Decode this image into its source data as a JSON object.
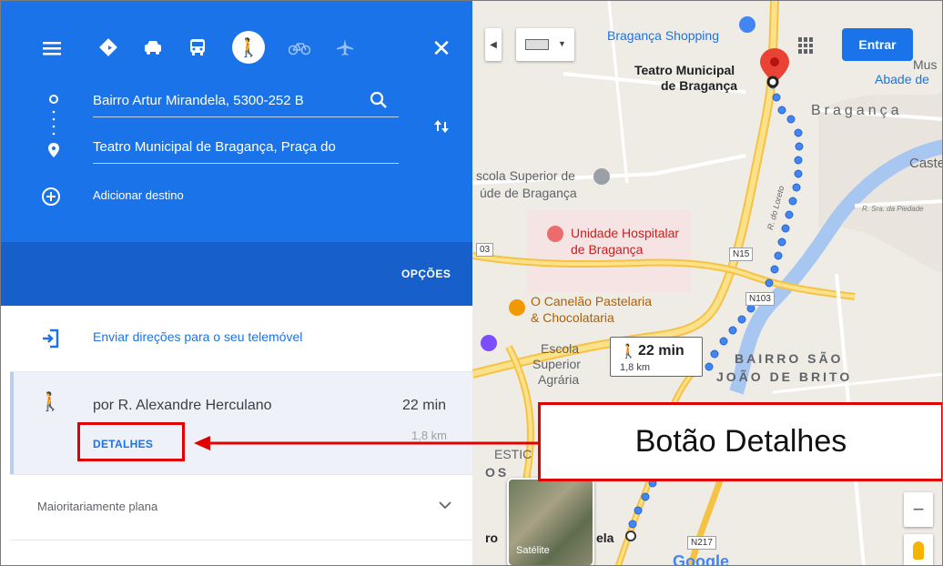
{
  "panel": {
    "origin": "Bairro Artur Mirandela, 5300-252 B",
    "destination": "Teatro Municipal de Bragança, Praça do",
    "add_destination": "Adicionar destino",
    "options": "OPÇÕES",
    "send_link": "Enviar direções para o seu telemóvel",
    "route_name": "por R. Alexandre Herculano",
    "route_time": "22 min",
    "route_distance": "1,8 km",
    "details_label": "DETALHES",
    "terrain": "Maioritariamente plana",
    "modes": [
      "best-route-icon",
      "car-icon",
      "transit-icon",
      "walking-icon",
      "bicycle-icon",
      "flight-icon"
    ],
    "active_mode": "walking-icon"
  },
  "map": {
    "signin": "Entrar",
    "teatro_line1": "Teatro Municipal",
    "teatro_line2": "de Bragança",
    "braganca_shopping": "Bragança Shopping",
    "braganca_town": "Bragança",
    "castel": "Castel",
    "mus": "Mus",
    "abade": "Abade de",
    "escola_saude_1": "scola Superior de",
    "escola_saude_2": "úde de Bragança",
    "hospital_1": "Unidade Hospitalar",
    "hospital_2": "de Bragança",
    "canelao_1": "O Canelão Pastelaria",
    "canelao_2": "& Chocolataria",
    "escola_agr_1": "Escola",
    "escola_agr_2": "Superior",
    "escola_agr_3": "Agrária",
    "bairro_1": "BAIRRO SÃO",
    "bairro_2": "JOÃO DE BRITO",
    "sra_piedade": "R. Sra. da Piedade",
    "r_loreto": "R. do Loreto",
    "n15": "N15",
    "n103": "N103",
    "n217": "N217",
    "n03": "03",
    "estic": "ESTIC",
    "os": "OS",
    "ro": "ro",
    "ela": "ela",
    "satellite": "Satélite",
    "walk_time": "22 min",
    "walk_dist": "1,8 km",
    "google": "Google"
  },
  "annotation": {
    "label": "Botão Detalhes"
  },
  "colors": {
    "panel_blue": "#1a73e8",
    "route_blue": "#4285f4",
    "annotation_red": "#e00000"
  }
}
